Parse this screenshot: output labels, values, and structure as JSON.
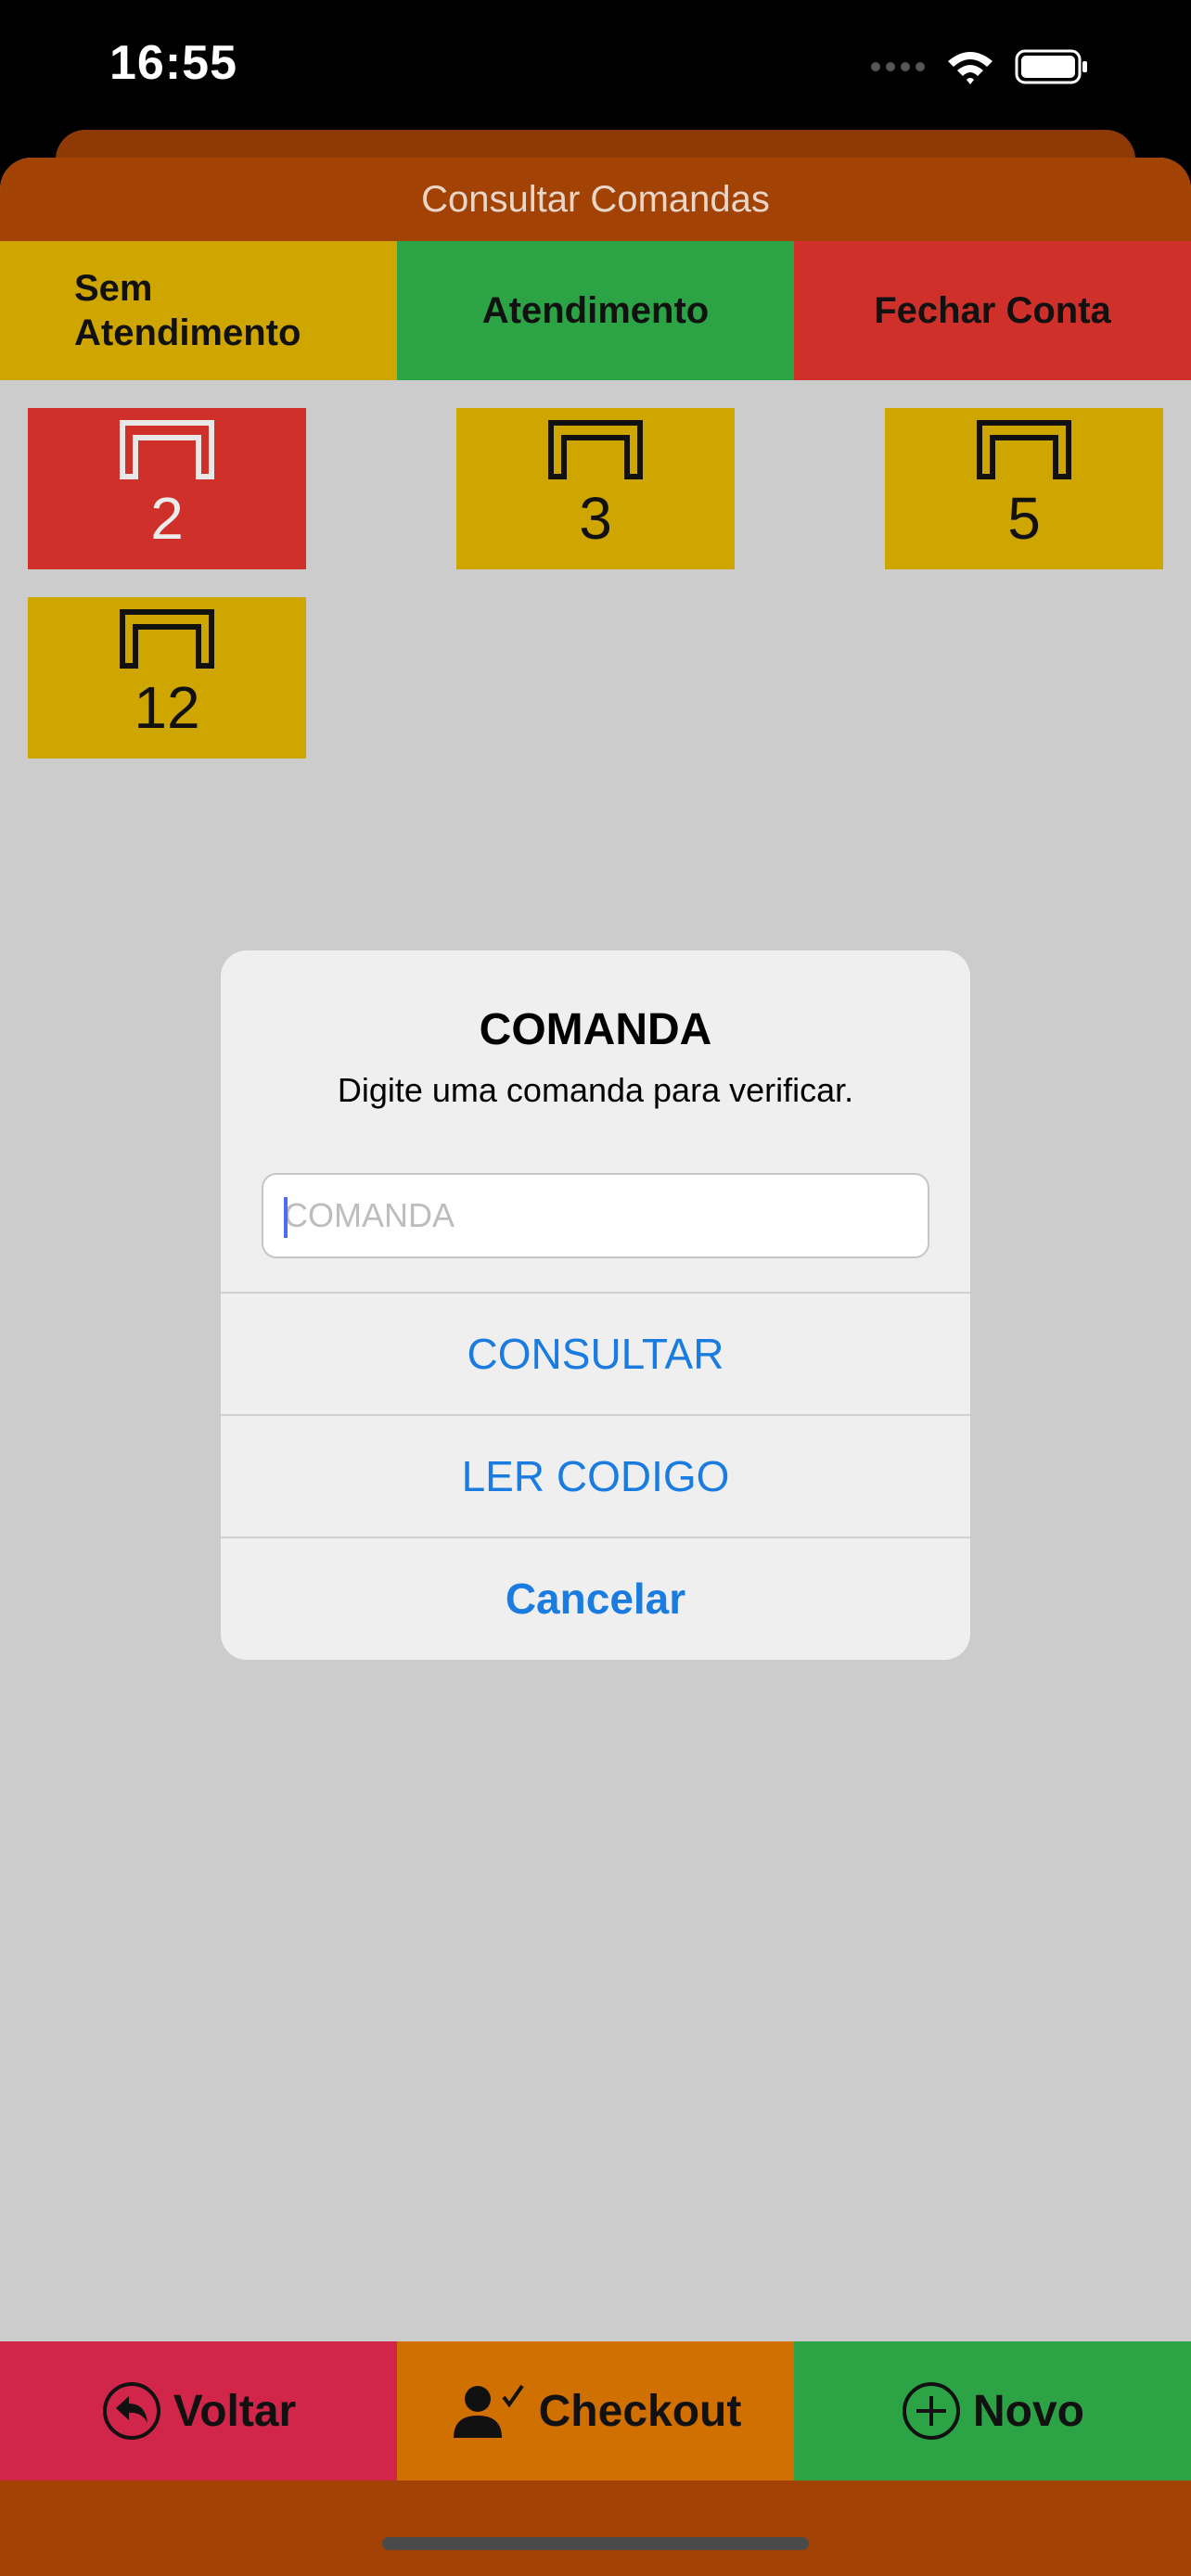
{
  "status_bar": {
    "time": "16:55"
  },
  "header": {
    "title": "Consultar Comandas"
  },
  "legend": {
    "sem_atendimento_line1": "Sem",
    "sem_atendimento_line2": "Atendimento",
    "atendimento": "Atendimento",
    "fechar_conta": "Fechar Conta"
  },
  "tables": [
    {
      "number": "2",
      "status": "fechar-conta",
      "color": "#d0302a"
    },
    {
      "number": "3",
      "status": "sem-atendimento",
      "color": "#cfa500"
    },
    {
      "number": "5",
      "status": "sem-atendimento",
      "color": "#cfa500"
    },
    {
      "number": "12",
      "status": "sem-atendimento",
      "color": "#cfa500"
    }
  ],
  "dialog": {
    "title": "COMANDA",
    "message": "Digite uma comanda para verificar.",
    "input_placeholder": "COMANDA",
    "input_value": "",
    "consultar": "CONSULTAR",
    "ler_codigo": "LER CODIGO",
    "cancelar": "Cancelar"
  },
  "bottom_bar": {
    "voltar": "Voltar",
    "checkout": "Checkout",
    "novo": "Novo"
  },
  "colors": {
    "header": "#a34205",
    "yellow": "#cfa500",
    "green": "#2ca345",
    "red": "#d0302a",
    "pink": "#d1264a",
    "orange": "#cf7000",
    "link_blue": "#1a7ce0"
  }
}
